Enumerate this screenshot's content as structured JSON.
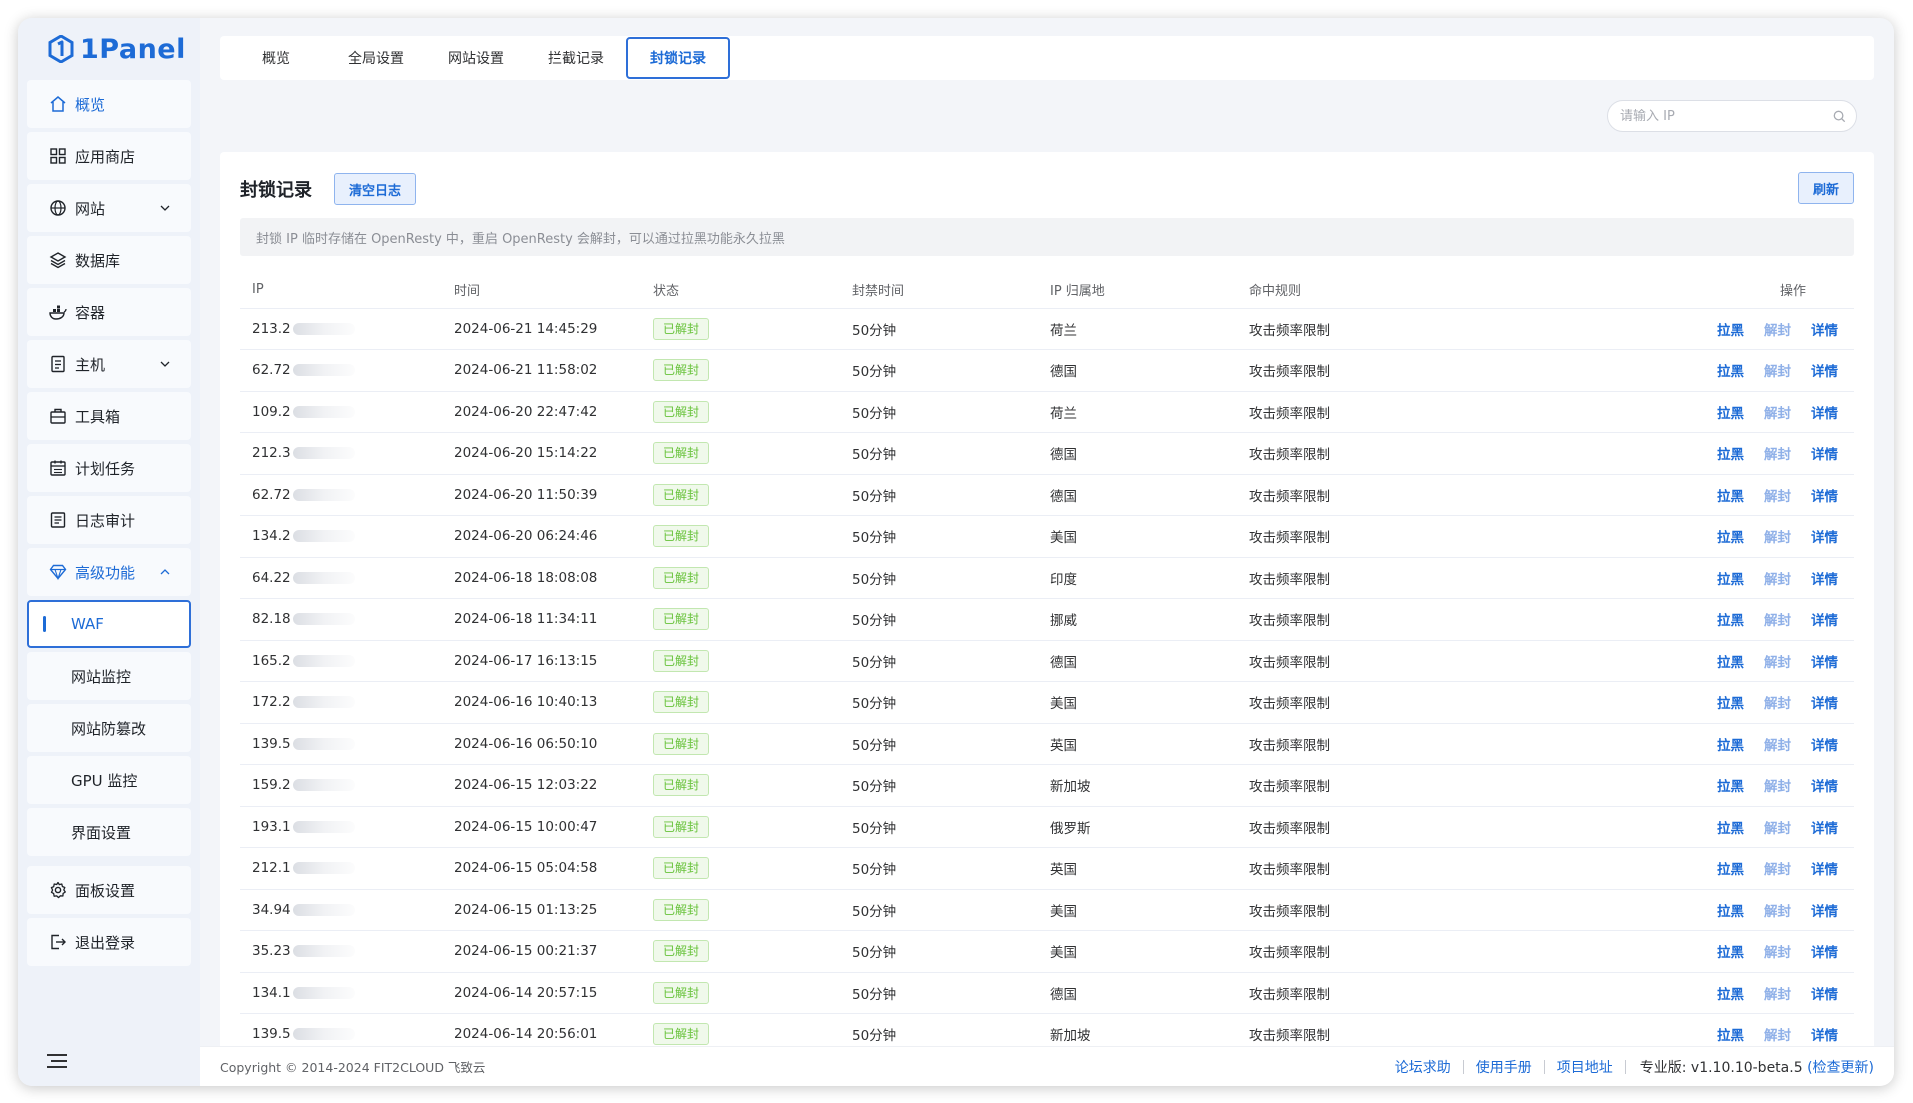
{
  "app": {
    "name": "1Panel",
    "brand_color": "#1d6bd6"
  },
  "sidebar": {
    "items": [
      {
        "key": "overview",
        "label": "概览",
        "icon": "home-icon",
        "active": true
      },
      {
        "key": "appstore",
        "label": "应用商店",
        "icon": "grid-icon"
      },
      {
        "key": "website",
        "label": "网站",
        "icon": "globe-icon",
        "chevron": "down"
      },
      {
        "key": "database",
        "label": "数据库",
        "icon": "layers-icon"
      },
      {
        "key": "container",
        "label": "容器",
        "icon": "docker-icon"
      },
      {
        "key": "host",
        "label": "主机",
        "icon": "server-icon",
        "chevron": "down"
      },
      {
        "key": "toolbox",
        "label": "工具箱",
        "icon": "toolbox-icon"
      },
      {
        "key": "cron",
        "label": "计划任务",
        "icon": "calendar-icon"
      },
      {
        "key": "logs",
        "label": "日志审计",
        "icon": "log-icon"
      },
      {
        "key": "advanced",
        "label": "高级功能",
        "icon": "diamond-icon",
        "chevron": "up",
        "active": true
      }
    ],
    "subitems": [
      {
        "key": "waf",
        "label": "WAF",
        "selected": true
      },
      {
        "key": "monitor",
        "label": "网站监控"
      },
      {
        "key": "tamper",
        "label": "网站防篡改"
      },
      {
        "key": "gpu",
        "label": "GPU 监控"
      },
      {
        "key": "ui",
        "label": "界面设置"
      }
    ],
    "bottom": [
      {
        "key": "settings",
        "label": "面板设置",
        "icon": "gear-icon"
      },
      {
        "key": "logout",
        "label": "退出登录",
        "icon": "logout-icon"
      }
    ]
  },
  "tabs": [
    "概览",
    "全局设置",
    "网站设置",
    "拦截记录",
    "封锁记录"
  ],
  "active_tab": 4,
  "search": {
    "placeholder": "请输入 IP",
    "value": ""
  },
  "card": {
    "title": "封锁记录",
    "clear_label": "清空日志",
    "refresh_label": "刷新",
    "notice": "封锁 IP 临时存储在 OpenResty 中，重启 OpenResty 会解封，可以通过拉黑功能永久拉黑"
  },
  "table": {
    "columns": [
      "IP",
      "时间",
      "状态",
      "封禁时间",
      "IP 归属地",
      "命中规则",
      "操作"
    ],
    "actions": [
      "拉黑",
      "解封",
      "详情"
    ],
    "rows": [
      {
        "ip": "213.2",
        "time": "2024-06-21 14:45:29",
        "status": "已解封",
        "duration": "50分钟",
        "location": "荷兰",
        "rule": "攻击频率限制"
      },
      {
        "ip": "62.72",
        "time": "2024-06-21 11:58:02",
        "status": "已解封",
        "duration": "50分钟",
        "location": "德国",
        "rule": "攻击频率限制"
      },
      {
        "ip": "109.2",
        "time": "2024-06-20 22:47:42",
        "status": "已解封",
        "duration": "50分钟",
        "location": "荷兰",
        "rule": "攻击频率限制"
      },
      {
        "ip": "212.3",
        "time": "2024-06-20 15:14:22",
        "status": "已解封",
        "duration": "50分钟",
        "location": "德国",
        "rule": "攻击频率限制"
      },
      {
        "ip": "62.72",
        "time": "2024-06-20 11:50:39",
        "status": "已解封",
        "duration": "50分钟",
        "location": "德国",
        "rule": "攻击频率限制"
      },
      {
        "ip": "134.2",
        "time": "2024-06-20 06:24:46",
        "status": "已解封",
        "duration": "50分钟",
        "location": "美国",
        "rule": "攻击频率限制"
      },
      {
        "ip": "64.22",
        "time": "2024-06-18 18:08:08",
        "status": "已解封",
        "duration": "50分钟",
        "location": "印度",
        "rule": "攻击频率限制"
      },
      {
        "ip": "82.18",
        "time": "2024-06-18 11:34:11",
        "status": "已解封",
        "duration": "50分钟",
        "location": "挪威",
        "rule": "攻击频率限制"
      },
      {
        "ip": "165.2",
        "time": "2024-06-17 16:13:15",
        "status": "已解封",
        "duration": "50分钟",
        "location": "德国",
        "rule": "攻击频率限制"
      },
      {
        "ip": "172.2",
        "time": "2024-06-16 10:40:13",
        "status": "已解封",
        "duration": "50分钟",
        "location": "美国",
        "rule": "攻击频率限制"
      },
      {
        "ip": "139.5",
        "time": "2024-06-16 06:50:10",
        "status": "已解封",
        "duration": "50分钟",
        "location": "英国",
        "rule": "攻击频率限制"
      },
      {
        "ip": "159.2",
        "time": "2024-06-15 12:03:22",
        "status": "已解封",
        "duration": "50分钟",
        "location": "新加坡",
        "rule": "攻击频率限制"
      },
      {
        "ip": "193.1",
        "time": "2024-06-15 10:00:47",
        "status": "已解封",
        "duration": "50分钟",
        "location": "俄罗斯",
        "rule": "攻击频率限制"
      },
      {
        "ip": "212.1",
        "time": "2024-06-15 05:04:58",
        "status": "已解封",
        "duration": "50分钟",
        "location": "英国",
        "rule": "攻击频率限制"
      },
      {
        "ip": "34.94",
        "time": "2024-06-15 01:13:25",
        "status": "已解封",
        "duration": "50分钟",
        "location": "美国",
        "rule": "攻击频率限制"
      },
      {
        "ip": "35.23",
        "time": "2024-06-15 00:21:37",
        "status": "已解封",
        "duration": "50分钟",
        "location": "美国",
        "rule": "攻击频率限制"
      },
      {
        "ip": "134.1",
        "time": "2024-06-14 20:57:15",
        "status": "已解封",
        "duration": "50分钟",
        "location": "德国",
        "rule": "攻击频率限制"
      },
      {
        "ip": "139.5",
        "time": "2024-06-14 20:56:01",
        "status": "已解封",
        "duration": "50分钟",
        "location": "新加坡",
        "rule": "攻击频率限制"
      }
    ]
  },
  "footer": {
    "copyright": "Copyright © 2014-2024 FIT2CLOUD 飞致云",
    "links": [
      "论坛求助",
      "使用手册",
      "项目地址"
    ],
    "edition_label": "专业版:",
    "version": "v1.10.10-beta.5",
    "update_label": "(检查更新)"
  }
}
